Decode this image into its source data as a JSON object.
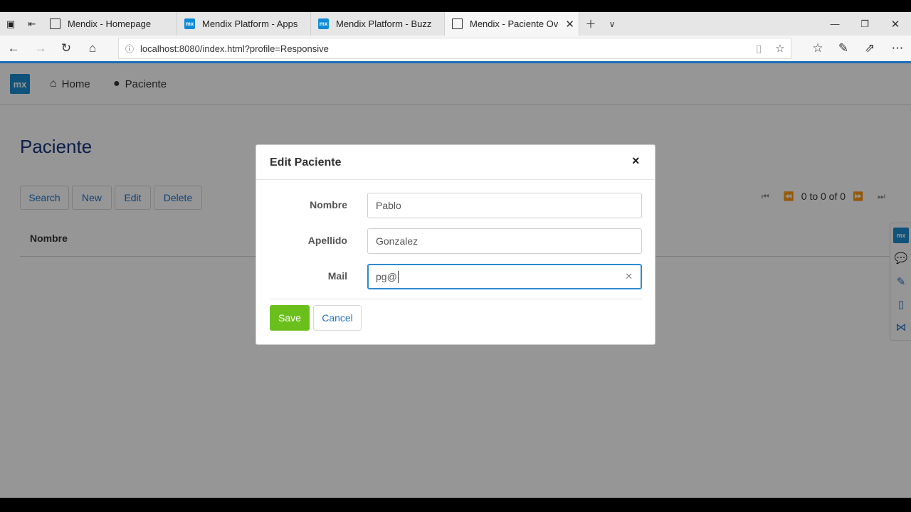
{
  "browser": {
    "tabs": [
      {
        "label": "Mendix - Homepage",
        "favicon": "page-icon"
      },
      {
        "label": "Mendix Platform - Apps",
        "favicon": "mx-icon"
      },
      {
        "label": "Mendix Platform - Buzz",
        "favicon": "mx-icon"
      },
      {
        "label": "Mendix - Paciente Over",
        "favicon": "page-icon",
        "active": true
      }
    ],
    "mx_favicon_text": "mx",
    "address": "localhost:8080/index.html?profile=Responsive",
    "accent_color": "#1a6fb5"
  },
  "app": {
    "logo_text": "mx",
    "menu": [
      {
        "label": "Home",
        "icon": "home-icon"
      },
      {
        "label": "Paciente",
        "icon": "user-icon"
      }
    ],
    "page_title": "Paciente",
    "toolbar": {
      "search": "Search",
      "new": "New",
      "edit": "Edit",
      "delete": "Delete"
    },
    "pager": {
      "status": "0 to 0 of 0"
    },
    "grid": {
      "columns": [
        "Nombre"
      ]
    },
    "sidepanel": {
      "logo_text": "mx"
    }
  },
  "modal": {
    "title": "Edit Paciente",
    "close": "×",
    "fields": [
      {
        "label": "Nombre",
        "value": "Pablo"
      },
      {
        "label": "Apellido",
        "value": "Gonzalez"
      },
      {
        "label": "Mail",
        "value": "pg@"
      }
    ],
    "save_label": "Save",
    "cancel_label": "Cancel",
    "save_color": "#6bbf1c"
  }
}
